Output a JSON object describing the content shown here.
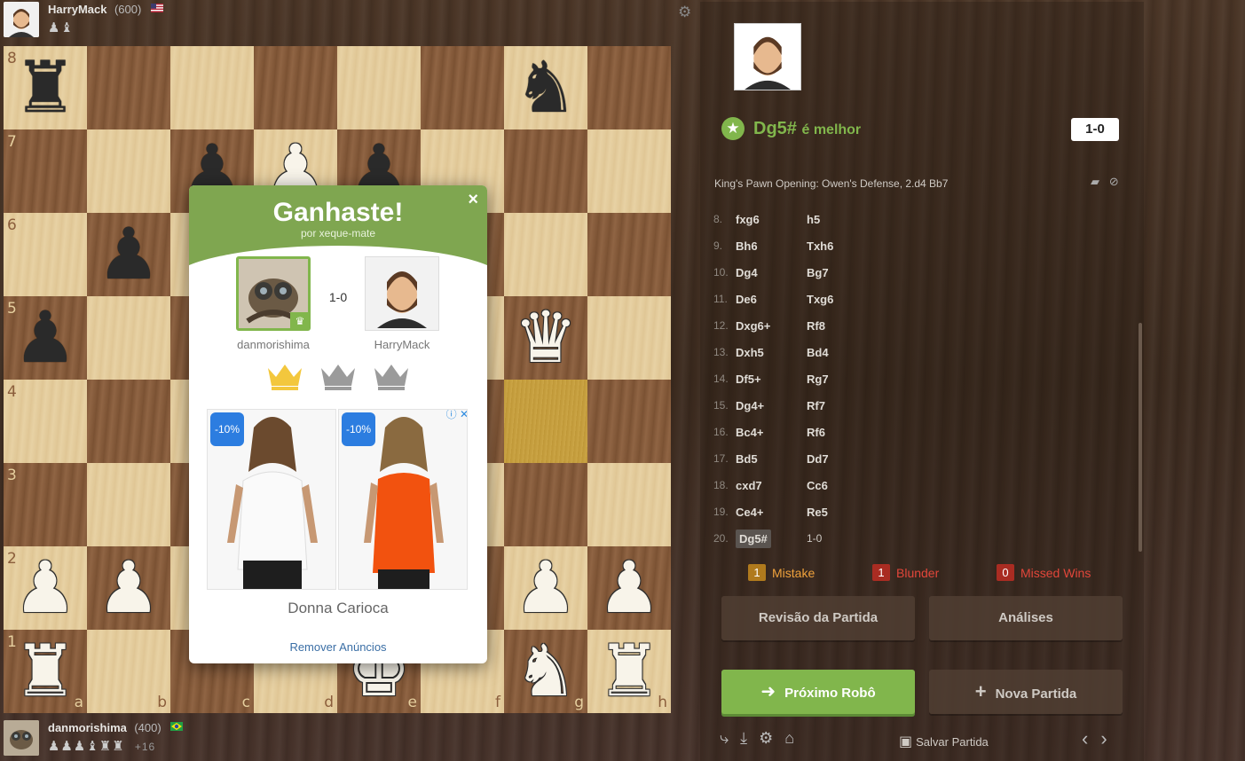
{
  "top_player": {
    "name": "HarryMack",
    "rating": "(600)",
    "flag": "US",
    "captured": "♟♝"
  },
  "bottom_player": {
    "name": "danmorishima",
    "rating": "(400)",
    "flag": "BR",
    "captured": "♟♟♟♝♜♜",
    "advantage": "+16"
  },
  "board": {
    "ranks": [
      "8",
      "7",
      "6",
      "5",
      "4",
      "3",
      "2",
      "1"
    ],
    "files": [
      "a",
      "b",
      "c",
      "d",
      "e",
      "f",
      "g",
      "h"
    ]
  },
  "modal": {
    "title": "Ganhaste!",
    "subtitle": "por xeque-mate",
    "close": "×",
    "score": "1-0",
    "left_name": "danmorishima",
    "right_name": "HarryMack",
    "ad_badge_a": "-10%",
    "ad_badge_b": "-10%",
    "ad_brand": "Donna Carioca",
    "remove_ads": "Remover Anúncios"
  },
  "panel": {
    "best_move": "Dg5#",
    "best_suffix": "é melhor",
    "score_badge": "1-0",
    "opening": "King's Pawn Opening: Owen's Defense, 2.d4 Bb7",
    "moves": [
      {
        "n": "8.",
        "w": "fxg6",
        "b": "h5"
      },
      {
        "n": "9.",
        "w": "Bh6",
        "b": "Txh6"
      },
      {
        "n": "10.",
        "w": "Dg4",
        "b": "Bg7"
      },
      {
        "n": "11.",
        "w": "De6",
        "b": "Txg6"
      },
      {
        "n": "12.",
        "w": "Dxg6+",
        "b": "Rf8"
      },
      {
        "n": "13.",
        "w": "Dxh5",
        "b": "Bd4"
      },
      {
        "n": "14.",
        "w": "Df5+",
        "b": "Rg7"
      },
      {
        "n": "15.",
        "w": "Dg4+",
        "b": "Rf7"
      },
      {
        "n": "16.",
        "w": "Bc4+",
        "b": "Rf6"
      },
      {
        "n": "17.",
        "w": "Bd5",
        "b": "Dd7"
      },
      {
        "n": "18.",
        "w": "cxd7",
        "b": "Cc6"
      },
      {
        "n": "19.",
        "w": "Ce4+",
        "b": "Re5"
      },
      {
        "n": "20.",
        "w": "Dg5#",
        "b": "1-0"
      }
    ],
    "mistake": {
      "count": "1",
      "label": "Mistake",
      "color": "#f0a23c"
    },
    "blunder": {
      "count": "1",
      "label": "Blunder",
      "color": "#e2463a"
    },
    "missed": {
      "count": "0",
      "label": "Missed Wins",
      "color": "#e2463a"
    },
    "review_btn": "Revisão da Partida",
    "analysis_btn": "Análises",
    "next_btn": "Próximo Robô",
    "new_btn": "Nova Partida",
    "save_label": "Salvar Partida"
  }
}
